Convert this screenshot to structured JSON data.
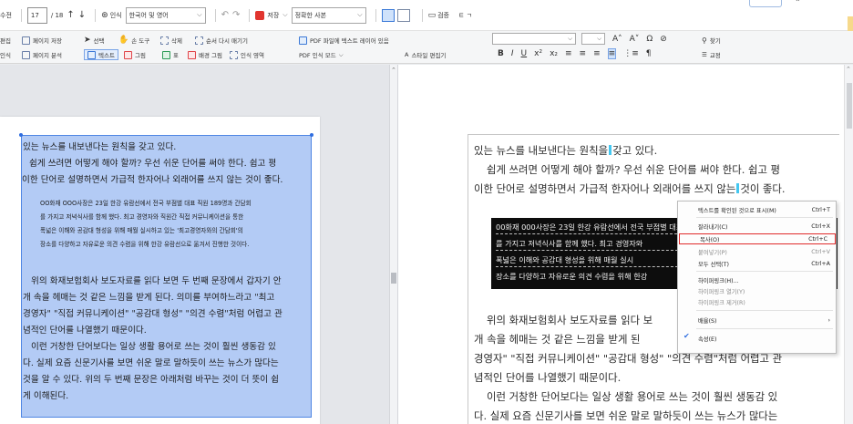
{
  "toolbar_row1": {
    "partial_label": "수전",
    "page_current": "17",
    "page_total": "/ 18",
    "ocr_label": "인식",
    "lang_select": "한국어 및 영어",
    "save_label": "저장",
    "mode_select": "정확한 사본",
    "review_label": "검증",
    "extra_glyphs": "ㅌ ㄱ"
  },
  "toolbar_row2": {
    "edit_label": "편집",
    "page_save": "페이지 저장",
    "ocr_partial": "인식",
    "page_analyze": "페이지 분석",
    "select": "선택",
    "hand_tool": "손 도구",
    "delete": "삭제",
    "reorder": "순서 다시 매기기",
    "text": "텍스트",
    "picture": "그림",
    "table": "표",
    "bg_picture": "배경 그림",
    "ocr_area": "인식 영역",
    "pdf_text_layer": "PDF 파일에 텍스트 레이어 있음",
    "pdf_ocr_mode": "PDF 인식 모드",
    "style_editor": "스타일 편집기",
    "find": "찾기",
    "proofread": "교정"
  },
  "left_page": {
    "lines": [
      "있는 뉴스를 내보낸다는 원칙을 갖고 있다.",
      "쉽게 쓰려면 어떻게 해야 할까? 우선 쉬운 단어를 써야 한다. 쉽고 평",
      "이한 단어로 설명하면서 가급적 한자어나 외래어를 쓰지 않는 것이 좋다."
    ],
    "quote": [
      "OO화재 OOO사장은 23일 한강 유람선에서 전국 부점별 대표 직원 189명과 간담회",
      "를 가지고 저녁식사를 함께 했다. 최고 경영자와 직원간 직접 커뮤니케이션을 통한",
      "폭넓은 이해와 공감대 형성을 위해 매월 실시하고 있는 '최고경영자와의 간담회'의",
      "장소를 다양하고 자유로운 의견 수렴을 위해 한강 유람선으로 옮겨서 진행한 것이다."
    ],
    "lines2": [
      "위의 화재보험회사 보도자료를 읽다 보면 두 번째 문장에서 갑자기 안",
      "개 속을 헤매는 것 같은 느낌을 받게 된다. 의미를 부여하느라고 \"최고",
      "경영자\" \"직접 커뮤니케이션\" \"공감대 형성\" \"의견 수렴\"처럼 어렵고 관",
      "념적인 단어를 나열했기 때문이다.",
      "이런 거창한 단어보다는 일상 생활 용어로 쓰는 것이 훨씬 생동감 있",
      "다. 실제 요즘 신문기사를 보면 쉬운 말로 말하듯이 쓰는 뉴스가 많다는",
      "것을 알 수 있다. 위의 두 번째 문장은 아래처럼 바꾸는 것이 더 뜻이 쉽",
      "게 이해된다."
    ]
  },
  "right_page": {
    "line1a": "있는 뉴스를 내보낸다는 원칙을",
    "line1b": "갖고 있다.",
    "line2": "쉽게 쓰려면 어떻게 해야 할까? 우선 쉬운 단어를 써야 한다. 쉽고 평",
    "line3a": "이한 단어로 설명하면서 가급적 한자어나 외래어를 쓰지 않는",
    "line3b": "것이 좋다.",
    "quote": [
      "00화재 000사장은 23일 한강 유람선에서 전국 부점별 대표 직원 189명과 간담회",
      "를 가지고 저녁식사를 함께 했다. 최고 경영자와",
      "폭넓은 이해와 공감대 형성을 위해 매월 실시",
      "장소를 다양하고 자유로운 의견 수렴을 위해 한강"
    ],
    "lines2": [
      "위의 화재보험회사 보도자료를 읽다 보",
      "개 속을 헤매는 것 같은 느낌을 받게 된",
      "경영자\" \"직접 커뮤니케이션\" \"공감대 형성\" \"의견 수렴\"처럼 어렵고 관",
      "념적인 단어를 나열했기 때문이다.",
      "이런 거창한 단어보다는 일상 생활 용어로 쓰는 것이 훨씬 생동감 있",
      "다. 실제 요즘 신문기사를 보면 쉬운 말로 말하듯이 쓰는 뉴스가 많다는"
    ]
  },
  "context_menu": {
    "items": [
      {
        "label": "텍스트를 확인된 것으로 표시(M)",
        "shortcut": "Ctrl+T",
        "disabled": false
      },
      {
        "label": "잘라내기(C)",
        "shortcut": "Ctrl+X",
        "disabled": false
      },
      {
        "label": "복사(O)",
        "shortcut": "Ctrl+C",
        "disabled": false,
        "highlighted": true
      },
      {
        "label": "붙여넣기(P)",
        "shortcut": "Ctrl+V",
        "disabled": true
      },
      {
        "label": "모두 선택(T)",
        "shortcut": "Ctrl+A",
        "disabled": false
      },
      {
        "label": "하이퍼링크(H)...",
        "shortcut": "",
        "disabled": false
      },
      {
        "label": "하이퍼링크 열기(Y)",
        "shortcut": "",
        "disabled": true
      },
      {
        "label": "하이퍼링크 제거(R)",
        "shortcut": "",
        "disabled": true
      },
      {
        "label": "배율(S)",
        "shortcut": "›",
        "disabled": false
      },
      {
        "label": "속성(E)",
        "shortcut": "",
        "disabled": false,
        "checked": true
      }
    ]
  },
  "colors": {
    "selection": "#4a82e6",
    "highlight_border": "#e02a2a",
    "cursor_mark": "#44c7f0",
    "brand_red": "#e1352f"
  }
}
